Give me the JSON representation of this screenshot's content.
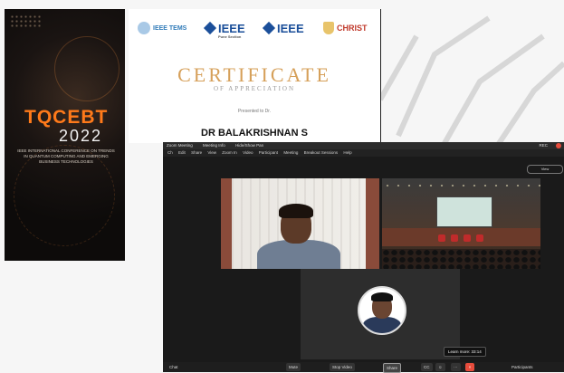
{
  "poster": {
    "title": "TQCEBT",
    "year": "2022",
    "subtitle": "IEEE INTERNATIONAL CONFERENCE ON TRENDS IN QUANTUM COMPUTING AND EMERGING BUSINESS TECHNOLOGIES"
  },
  "certificate": {
    "logos": {
      "tems": "IEEE TEMS",
      "ieee_pune": "IEEE",
      "ieee_pune_sub": "Pune Section",
      "ieee_plain": "IEEE",
      "christ": "CHRIST"
    },
    "title": "CERTIFICATE",
    "subtitle": "OF APPRECIATION",
    "presented_to": "Presented to Dr.",
    "recipient": "DR BALAKRISHNAN S"
  },
  "zoom": {
    "titlebar": {
      "app": "Zoom Meeting",
      "item1": "Meeting Info",
      "item2": "Hide/Show Pan",
      "right_text": "REC"
    },
    "menu": [
      "Ch",
      "Edit",
      "Share",
      "View",
      "Zoom In",
      "Video",
      "Participant",
      "Meeting",
      "Breakout Sessions",
      "Help"
    ],
    "view_toggle": "View",
    "tooltip": "Learn more: 33:14",
    "toolbar": {
      "chat_left": "Chat",
      "mute": "Mute",
      "stop_video": "Stop Video",
      "share": "Share",
      "cc": "CC",
      "reactions": "☺",
      "more": "···",
      "end": "×",
      "participants": "Participants"
    }
  },
  "colors": {
    "accent_orange": "#ff7a1a",
    "ieee_blue": "#1b4f9a",
    "cert_gold": "#d6a05a",
    "end_red": "#e74c3c"
  }
}
